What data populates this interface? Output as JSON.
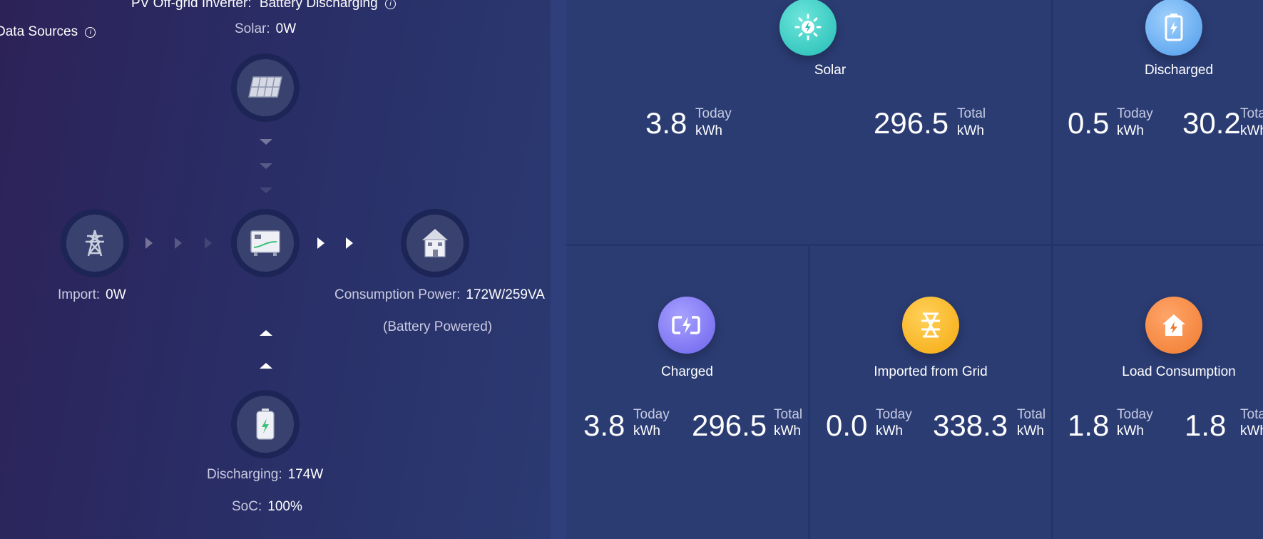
{
  "flow": {
    "inverter_label": "PV Off-grid Inverter:",
    "inverter_state": "Battery Discharging",
    "data_sources": "Data Sources",
    "solar_label": "Solar:",
    "solar_value": "0W",
    "import_label": "Import:",
    "import_value": "0W",
    "consumption_label": "Consumption Power:",
    "consumption_value": "172W/259VA",
    "consumption_note": "(Battery Powered)",
    "discharging_label": "Discharging:",
    "discharging_value": "174W",
    "soc_label": "SoC:",
    "soc_value": "100%"
  },
  "cards": [
    {
      "title": "Solar",
      "icon": "sun-icon",
      "color": "#2ec9c0",
      "today": "3.8",
      "total": "296.5",
      "today_label": "Today",
      "total_label": "Total",
      "unit": "kWh"
    },
    {
      "title": "Discharged",
      "icon": "battery-icon",
      "color": "#5aa9f2",
      "today": "0.5",
      "total": "30.2",
      "today_label": "Today",
      "total_label": "Total",
      "unit": "kWh"
    },
    {
      "title": "Charged",
      "icon": "charge-icon",
      "color": "#7a72f0",
      "today": "3.8",
      "total": "296.5",
      "today_label": "Today",
      "total_label": "Total",
      "unit": "kWh"
    },
    {
      "title": "Imported from Grid",
      "icon": "grid-tower-icon",
      "color": "#f7b51e",
      "today": "0.0",
      "total": "338.3",
      "today_label": "Today",
      "total_label": "Total",
      "unit": "kWh"
    },
    {
      "title": "Load Consumption",
      "icon": "home-load-icon",
      "color": "#f3873f",
      "today": "1.8",
      "total": "1.8",
      "today_label": "Today",
      "total_label": "Total",
      "unit": "kWh"
    }
  ]
}
